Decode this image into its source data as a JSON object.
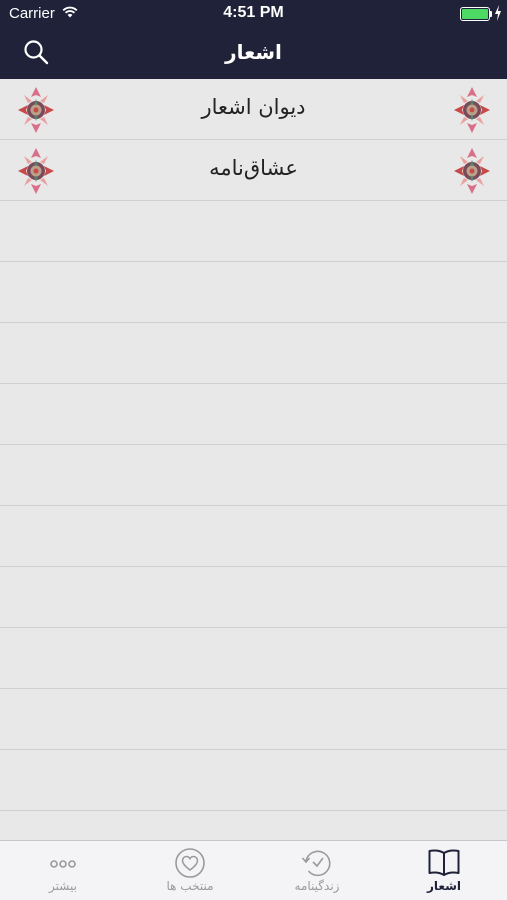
{
  "status_bar": {
    "carrier": "Carrier",
    "time": "4:51 PM",
    "battery_level": 1.0,
    "battery_color": "#4cd964"
  },
  "nav_bar": {
    "title": "اشعار",
    "search_icon": "search-icon",
    "background": "#1f2239"
  },
  "list": {
    "items": [
      {
        "label": "دیوان اشعار",
        "icon": "floral-ornament-icon"
      },
      {
        "label": "عشاق‌نامه",
        "icon": "floral-ornament-icon"
      }
    ]
  },
  "tab_bar": {
    "tabs": [
      {
        "label": "اشعار",
        "icon": "book-icon",
        "active": true
      },
      {
        "label": "زندگینامه",
        "icon": "history-icon",
        "active": false
      },
      {
        "label": "منتخب ها",
        "icon": "heart-icon",
        "active": false
      },
      {
        "label": "بیشتر",
        "icon": "more-icon",
        "active": false
      }
    ]
  }
}
